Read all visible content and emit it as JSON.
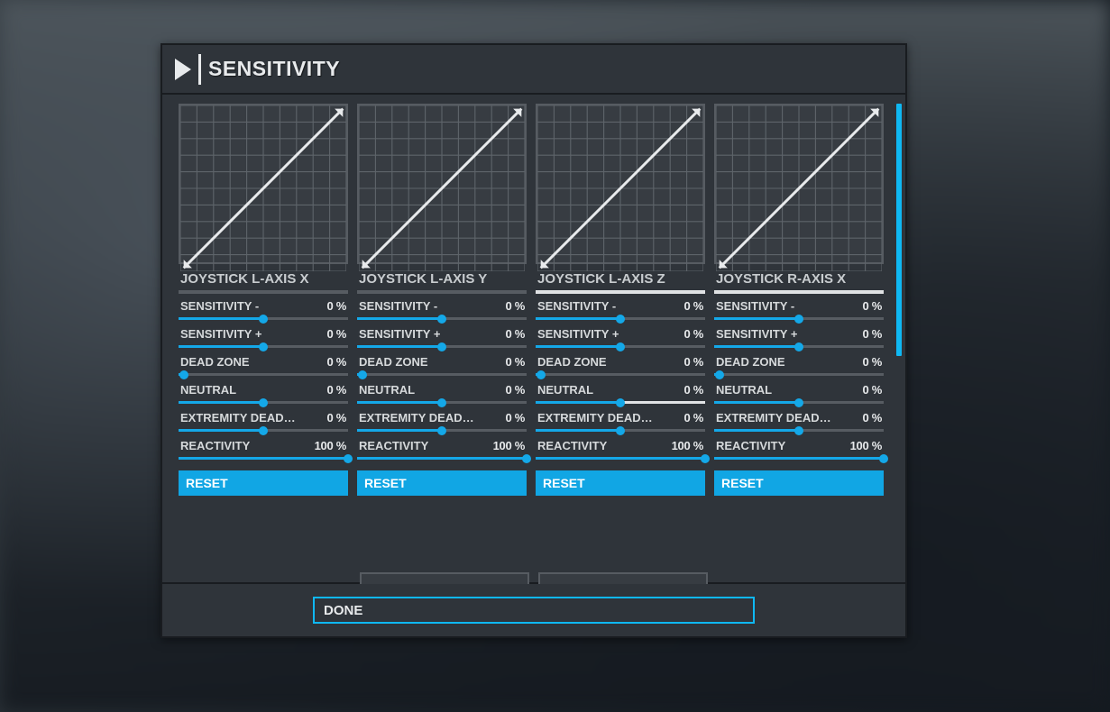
{
  "header": {
    "title": "SENSITIVITY"
  },
  "accent_color": "#11a6e4",
  "reset_label": "RESET",
  "done_label": "DONE",
  "sliders_meta": [
    {
      "key": "sens_minus",
      "label": "SENSITIVITY -"
    },
    {
      "key": "sens_plus",
      "label": "SENSITIVITY +"
    },
    {
      "key": "dead_zone",
      "label": "DEAD ZONE"
    },
    {
      "key": "neutral",
      "label": "NEUTRAL"
    },
    {
      "key": "ext_dead",
      "label": "EXTREMITY DEAD…"
    },
    {
      "key": "reactivity",
      "label": "REACTIVITY"
    }
  ],
  "panels": [
    {
      "title": "JOYSTICK L-AXIS X",
      "title_bright": false,
      "selected_slider": null,
      "values": {
        "sens_minus": {
          "val": 0,
          "fill": 50
        },
        "sens_plus": {
          "val": 0,
          "fill": 50
        },
        "dead_zone": {
          "val": 0,
          "fill": 3
        },
        "neutral": {
          "val": 0,
          "fill": 50
        },
        "ext_dead": {
          "val": 0,
          "fill": 50
        },
        "reactivity": {
          "val": 100,
          "fill": 100
        }
      }
    },
    {
      "title": "JOYSTICK L-AXIS Y",
      "title_bright": false,
      "selected_slider": null,
      "values": {
        "sens_minus": {
          "val": 0,
          "fill": 50
        },
        "sens_plus": {
          "val": 0,
          "fill": 50
        },
        "dead_zone": {
          "val": 0,
          "fill": 3
        },
        "neutral": {
          "val": 0,
          "fill": 50
        },
        "ext_dead": {
          "val": 0,
          "fill": 50
        },
        "reactivity": {
          "val": 100,
          "fill": 100
        }
      }
    },
    {
      "title": "JOYSTICK L-AXIS Z",
      "title_bright": true,
      "selected_slider": "neutral",
      "values": {
        "sens_minus": {
          "val": 0,
          "fill": 50
        },
        "sens_plus": {
          "val": 0,
          "fill": 50
        },
        "dead_zone": {
          "val": 0,
          "fill": 3
        },
        "neutral": {
          "val": 0,
          "fill": 50
        },
        "ext_dead": {
          "val": 0,
          "fill": 50
        },
        "reactivity": {
          "val": 100,
          "fill": 100
        }
      }
    },
    {
      "title": "JOYSTICK R-AXIS X",
      "title_bright": true,
      "selected_slider": null,
      "values": {
        "sens_minus": {
          "val": 0,
          "fill": 50
        },
        "sens_plus": {
          "val": 0,
          "fill": 50
        },
        "dead_zone": {
          "val": 0,
          "fill": 3
        },
        "neutral": {
          "val": 0,
          "fill": 50
        },
        "ext_dead": {
          "val": 0,
          "fill": 50
        },
        "reactivity": {
          "val": 100,
          "fill": 100
        }
      }
    }
  ],
  "chart_data": [
    {
      "type": "line",
      "title": "JOYSTICK L-AXIS X",
      "x": [
        0,
        1
      ],
      "y": [
        0,
        1
      ],
      "xlim": [
        0,
        1
      ],
      "ylim": [
        0,
        1
      ],
      "grid": true
    },
    {
      "type": "line",
      "title": "JOYSTICK L-AXIS Y",
      "x": [
        0,
        1
      ],
      "y": [
        0,
        1
      ],
      "xlim": [
        0,
        1
      ],
      "ylim": [
        0,
        1
      ],
      "grid": true
    },
    {
      "type": "line",
      "title": "JOYSTICK L-AXIS Z",
      "x": [
        0,
        1
      ],
      "y": [
        0,
        1
      ],
      "xlim": [
        0,
        1
      ],
      "ylim": [
        0,
        1
      ],
      "grid": true
    },
    {
      "type": "line",
      "title": "JOYSTICK R-AXIS X",
      "x": [
        0,
        1
      ],
      "y": [
        0,
        1
      ],
      "xlim": [
        0,
        1
      ],
      "ylim": [
        0,
        1
      ],
      "grid": true
    }
  ]
}
